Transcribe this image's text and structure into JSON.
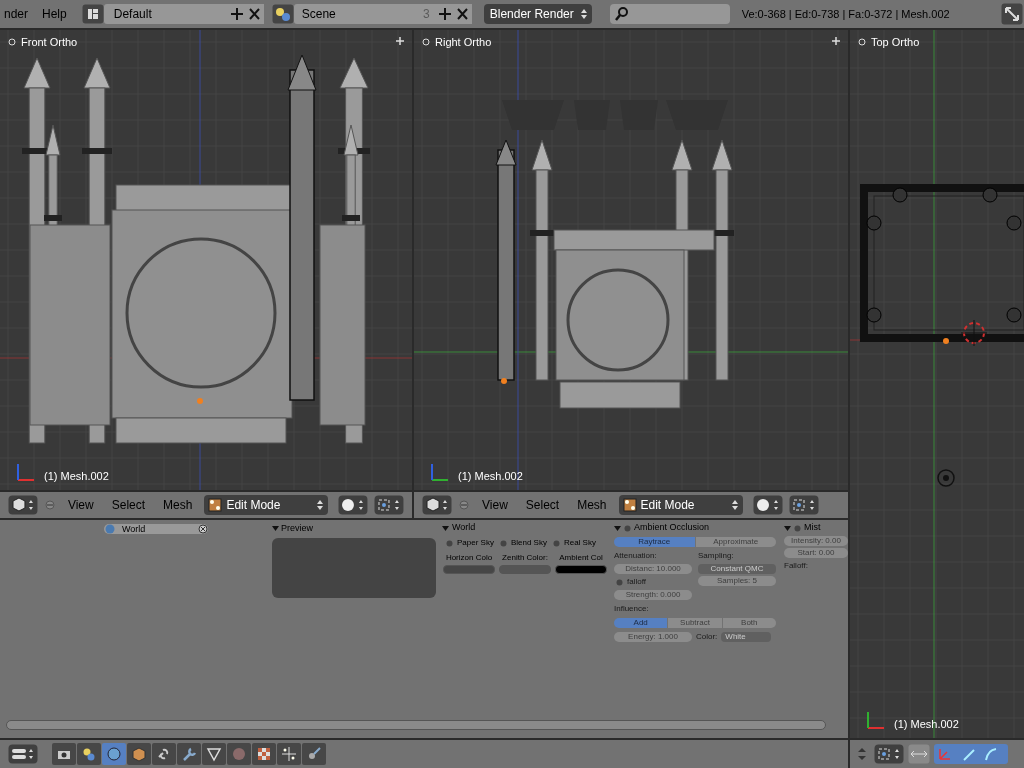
{
  "top_bar": {
    "menus": [
      "nder",
      "Help"
    ],
    "layout": "Default",
    "scene": "Scene",
    "scene_users": "3",
    "render_engine": "Blender Render",
    "stats": "Ve:0-368 | Ed:0-738 | Fa:0-372 | Mesh.002"
  },
  "viewports": [
    {
      "title": "Front Ortho",
      "object_label": "(1) Mesh.002",
      "kind": "front"
    },
    {
      "title": "Right Ortho",
      "object_label": "(1) Mesh.002",
      "kind": "right"
    },
    {
      "title": "Top Ortho",
      "object_label": "(1) Mesh.002",
      "kind": "top"
    }
  ],
  "viewport_headers": [
    {
      "menus": [
        "View",
        "Select",
        "Mesh"
      ],
      "mode": "Edit Mode"
    },
    {
      "menus": [
        "View",
        "Select",
        "Mesh"
      ],
      "mode": "Edit Mode"
    }
  ],
  "properties": {
    "world_id": "World",
    "preview_title": "Preview",
    "world_panel": {
      "title": "World",
      "sky_options": [
        {
          "label": "Paper Sky",
          "checked": false
        },
        {
          "label": "Blend Sky",
          "checked": false
        },
        {
          "label": "Real Sky",
          "checked": false
        }
      ],
      "colors": [
        {
          "label": "Horizon Colo",
          "color": "#464646"
        },
        {
          "label": "Zenith Color:",
          "color": "#555555"
        },
        {
          "label": "Ambient Col",
          "color": "#000000"
        }
      ]
    },
    "ao_panel": {
      "title": "Ambient Occlusion",
      "enabled": false,
      "gather": [
        {
          "label": "Raytrace",
          "selected": true
        },
        {
          "label": "Approximate",
          "selected": false
        }
      ],
      "attenuation_label": "Attenuation:",
      "distance": "Distanc: 10.000",
      "falloff": {
        "label": "falloff",
        "checked": false
      },
      "strength": "Strength: 0.000",
      "sampling_label": "Sampling:",
      "sampling_method": "Constant QMC",
      "samples": "Samples: 5",
      "influence_label": "Influence:",
      "blend": [
        {
          "label": "Add",
          "selected": true
        },
        {
          "label": "Subtract",
          "selected": false
        },
        {
          "label": "Both",
          "selected": false
        }
      ],
      "energy": "Energy: 1.000",
      "color_label": "Color:",
      "color_value": "White"
    },
    "mist_panel": {
      "title": "Mist",
      "enabled": false,
      "intensity": "Intensity: 0.00",
      "start": "Start: 0.00",
      "falloff_label": "Falloff:"
    }
  },
  "context_tabs": [
    {
      "kind": "render",
      "selected": false
    },
    {
      "kind": "scene",
      "selected": false
    },
    {
      "kind": "world",
      "selected": true
    },
    {
      "kind": "object",
      "selected": false
    },
    {
      "kind": "constraints",
      "selected": false
    },
    {
      "kind": "modifiers",
      "selected": false
    },
    {
      "kind": "mesh",
      "selected": false
    },
    {
      "kind": "material",
      "selected": false
    },
    {
      "kind": "texture",
      "selected": false
    },
    {
      "kind": "particles",
      "selected": false
    },
    {
      "kind": "physics",
      "selected": false
    }
  ]
}
